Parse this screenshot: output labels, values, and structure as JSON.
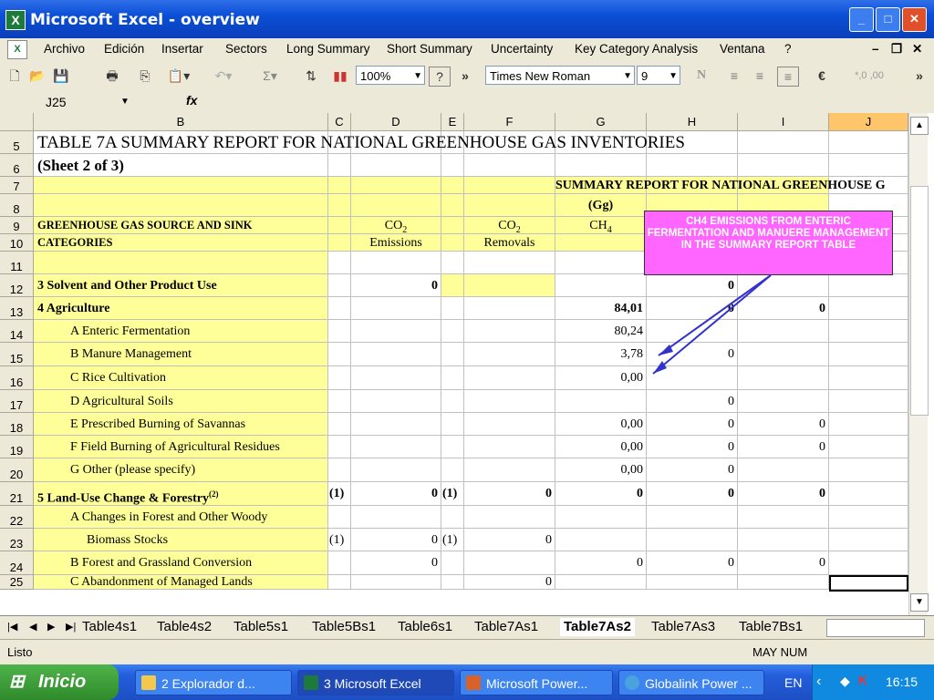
{
  "window": {
    "title": "Microsoft Excel - overview"
  },
  "menu": [
    "Archivo",
    "Edición",
    "Insertar",
    "Sectors",
    "Long Summary",
    "Short Summary",
    "Uncertainty",
    "Key Category Analysis",
    "Ventana",
    "?"
  ],
  "toolbar": {
    "zoom": "100%",
    "font": "Times New Roman",
    "size": "9",
    "bold_letter": "N",
    "euro": "€",
    "percent_lbl": "*,0 ,00",
    "sigma": "Σ"
  },
  "formula": {
    "cell_ref": "J25",
    "fx": "fx"
  },
  "columns": [
    "B",
    "C",
    "D",
    "E",
    "F",
    "G",
    "H",
    "I",
    "J"
  ],
  "rows": [
    {
      "num": "5",
      "cells": {
        "B": "TABLE 7A SUMMARY REPORT FOR NATIONAL GREENHOUSE GAS INVENTORIES"
      }
    },
    {
      "num": "6",
      "cells": {
        "B": "(Sheet 2 of 3)"
      }
    },
    {
      "num": "7",
      "cells": {
        "G": "SUMMARY REPORT FOR NATIONAL GREENHOUSE G"
      }
    },
    {
      "num": "8",
      "cells": {
        "G": "(Gg)"
      }
    },
    {
      "num": "9",
      "cells": {
        "B": "GREENHOUSE GAS SOURCE AND SINK",
        "D": "CO",
        "F": "CO",
        "G": "CH"
      }
    },
    {
      "num": "10",
      "cells": {
        "B": "CATEGORIES",
        "D": "Emissions",
        "F": "Removals"
      }
    },
    {
      "num": "11",
      "cells": {}
    },
    {
      "num": "12",
      "cells": {
        "B": "3  Solvent and Other Product Use",
        "D": "0",
        "H": "0"
      }
    },
    {
      "num": "13",
      "cells": {
        "B": "4  Agriculture",
        "G": "84,01",
        "H": "0",
        "I": "0"
      }
    },
    {
      "num": "14",
      "cells": {
        "B": "A  Enteric Fermentation",
        "G": "80,24"
      }
    },
    {
      "num": "15",
      "cells": {
        "B": "B  Manure Management",
        "G": "3,78",
        "H": "0"
      }
    },
    {
      "num": "16",
      "cells": {
        "B": "C  Rice Cultivation",
        "G": "0,00"
      }
    },
    {
      "num": "17",
      "cells": {
        "B": "D  Agricultural Soils",
        "H": "0"
      }
    },
    {
      "num": "18",
      "cells": {
        "B": "E  Prescribed Burning of Savannas",
        "G": "0,00",
        "H": "0",
        "I": "0"
      }
    },
    {
      "num": "19",
      "cells": {
        "B": "F  Field Burning of Agricultural Residues",
        "G": "0,00",
        "H": "0",
        "I": "0"
      }
    },
    {
      "num": "20",
      "cells": {
        "B": "G  Other (please specify)",
        "G": "0,00",
        "H": "0"
      }
    },
    {
      "num": "21",
      "cells": {
        "B": "5  Land-Use Change & Forestry",
        "B_sup": "(2)",
        "C": "(1)",
        "D": "0",
        "E": "(1)",
        "F": "0",
        "G": "0",
        "H": "0",
        "I": "0"
      }
    },
    {
      "num": "22",
      "cells": {
        "B": "A  Changes in Forest and Other Woody"
      }
    },
    {
      "num": "23",
      "cells": {
        "B": "Biomass Stocks",
        "C": "(1)",
        "D": "0",
        "E": "(1)",
        "F": "0"
      }
    },
    {
      "num": "24",
      "cells": {
        "B": "B  Forest and Grassland Conversion",
        "D": "0",
        "G": "0",
        "H": "0",
        "I": "0"
      }
    },
    {
      "num": "25",
      "cells": {
        "B": "C  Abandonment of Managed Lands",
        "F": "0"
      }
    }
  ],
  "subscripts": {
    "co2": "2",
    "ch4": "4"
  },
  "callout": {
    "text": "CH4 EMISSIONS FROM ENTERIC FERMENTATION AND MANUERE MANAGEMENT IN THE SUMMARY REPORT TABLE"
  },
  "sheet_tabs": [
    "Table4s1",
    "Table4s2",
    "Table5s1",
    "Table5Bs1",
    "Table6s1",
    "Table7As1",
    "Table7As2",
    "Table7As3",
    "Table7Bs1"
  ],
  "active_tab": "Table7As2",
  "status": {
    "left": "Listo",
    "right": "MAY NUM"
  },
  "taskbar": {
    "start": "Inicio",
    "tasks": [
      {
        "label": "2 Explorador d...",
        "color": "#f2c94c"
      },
      {
        "label": "3 Microsoft Excel",
        "color": "#1d7a3a"
      },
      {
        "label": "Microsoft Power...",
        "color": "#d9622b"
      },
      {
        "label": "Globalink Power ...",
        "color": "#4aa3df"
      }
    ],
    "lang": "EN",
    "clock": "16:15"
  },
  "colors": {
    "yellow": "#ffff99",
    "callout": "#ff66ff",
    "arrow": "#3333cc"
  }
}
